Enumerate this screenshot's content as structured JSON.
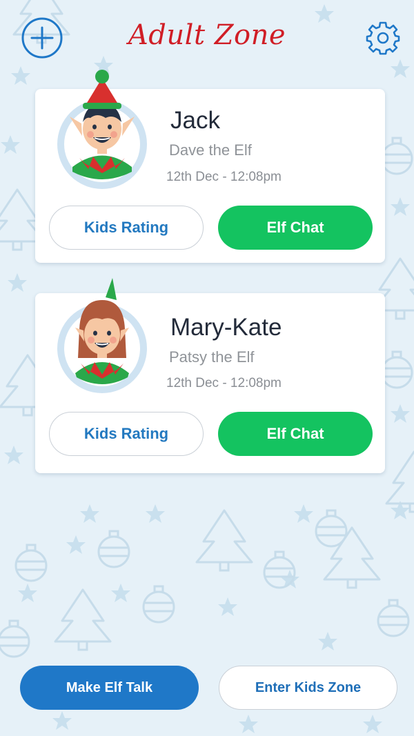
{
  "header": {
    "title": "Adult Zone",
    "add_icon": "plus-circle-icon",
    "settings_icon": "gear-icon"
  },
  "elves": [
    {
      "name": "Jack",
      "elf_name": "Dave the Elf",
      "date": "12th Dec - 12:08pm",
      "avatar": "boy-elf-avatar",
      "rating_label": "Kids Rating",
      "chat_label": "Elf Chat"
    },
    {
      "name": "Mary-Kate",
      "elf_name": "Patsy the Elf",
      "date": "12th Dec - 12:08pm",
      "avatar": "girl-elf-avatar",
      "rating_label": "Kids Rating",
      "chat_label": "Elf Chat"
    }
  ],
  "footer": {
    "primary_label": "Make Elf Talk",
    "secondary_label": "Enter Kids Zone"
  },
  "colors": {
    "title": "#d01e26",
    "accent_blue": "#1f78c8",
    "accent_green": "#14c360",
    "background": "#e6f1f8"
  }
}
